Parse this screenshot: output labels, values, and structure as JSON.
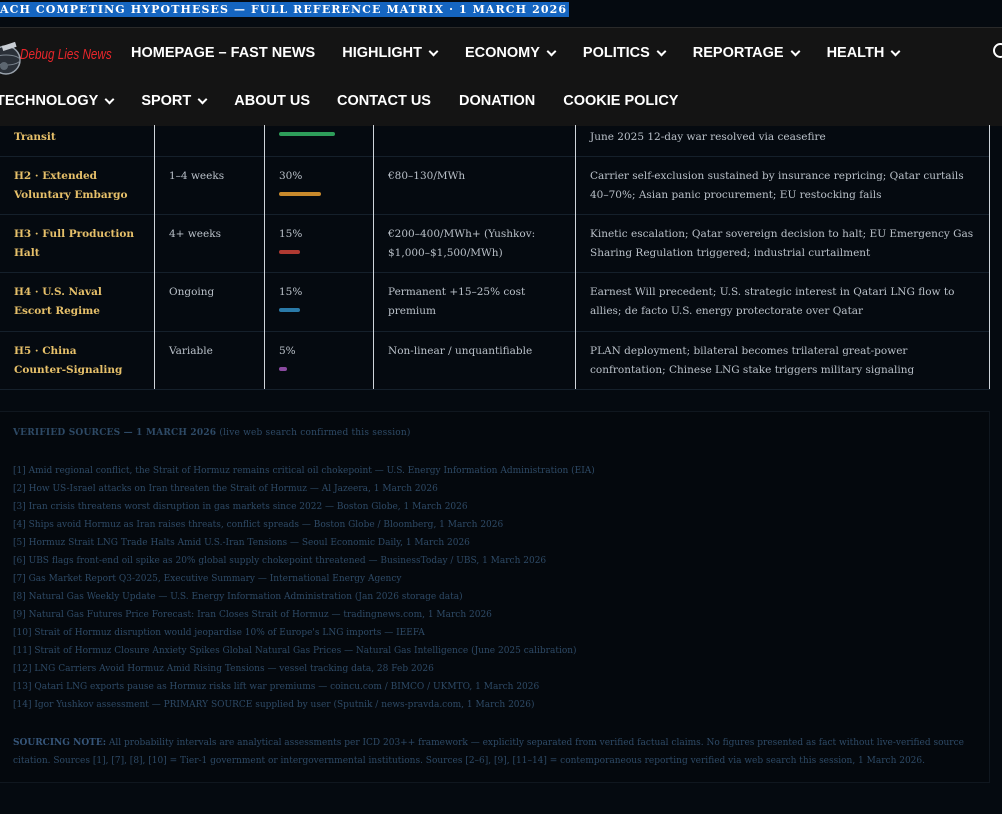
{
  "banner": {
    "text": "ACH COMPETING HYPOTHESES — FULL REFERENCE MATRIX · 1 MARCH 2026"
  },
  "logo": {
    "text": "Debug Lies News"
  },
  "nav": {
    "row1": [
      {
        "label": "HOMEPAGE – FAST NEWS",
        "dropdown": false
      },
      {
        "label": "HIGHLIGHT",
        "dropdown": true
      },
      {
        "label": "ECONOMY",
        "dropdown": true
      },
      {
        "label": "POLITICS",
        "dropdown": true
      },
      {
        "label": "REPORTAGE",
        "dropdown": true
      },
      {
        "label": "HEALTH",
        "dropdown": true
      }
    ],
    "row2": [
      {
        "label": "TECHNOLOGY",
        "dropdown": true
      },
      {
        "label": "SPORT",
        "dropdown": true
      },
      {
        "label": "ABOUT US",
        "dropdown": false
      },
      {
        "label": "CONTACT US",
        "dropdown": false
      },
      {
        "label": "DONATION",
        "dropdown": false
      },
      {
        "label": "COOKIE POLICY",
        "dropdown": false
      }
    ]
  },
  "table": {
    "rows": [
      {
        "hypothesis": "Transit",
        "duration": "",
        "probability": "",
        "prob_value": 40,
        "bar_color": "#2e9e5a",
        "price": "",
        "triggers": "June 2025 12-day war resolved via ceasefire"
      },
      {
        "hypothesis": "H2 · Extended Voluntary Embargo",
        "duration": "1–4 weeks",
        "probability": "30%",
        "prob_value": 30,
        "bar_color": "#c98a2c",
        "price": "€80–130/MWh",
        "triggers": "Carrier self-exclusion sustained by insurance repricing; Qatar curtails 40–70%; Asian panic procurement; EU restocking fails"
      },
      {
        "hypothesis": "H3 · Full Production Halt",
        "duration": "4+ weeks",
        "probability": "15%",
        "prob_value": 15,
        "bar_color": "#b03a32",
        "price": "€200–400/MWh+ (Yushkov: $1,000–$1,500/MWh)",
        "triggers": "Kinetic escalation; Qatar sovereign decision to halt; EU Emergency Gas Sharing Regulation triggered; industrial curtailment"
      },
      {
        "hypothesis": "H4 · U.S. Naval Escort Regime",
        "duration": "Ongoing",
        "probability": "15%",
        "prob_value": 15,
        "bar_color": "#2a7aa8",
        "price": "Permanent +15–25% cost premium",
        "triggers": "Earnest Will precedent; U.S. strategic interest in Qatari LNG flow to allies; de facto U.S. energy protectorate over Qatar"
      },
      {
        "hypothesis": "H5 · China Counter-Signaling",
        "duration": "Variable",
        "probability": "5%",
        "prob_value": 5,
        "bar_color": "#8a4aa0",
        "price": "Non-linear / unquantifiable",
        "triggers": "PLAN deployment; bilateral becomes trilateral great-power confrontation; Chinese LNG stake triggers military signaling"
      }
    ]
  },
  "sources": {
    "heading_bold": "VERIFIED SOURCES — 1 MARCH 2026",
    "heading_rest": " (live web search confirmed this session)",
    "items": [
      "[1] Amid regional conflict, the Strait of Hormuz remains critical oil chokepoint — U.S. Energy Information Administration (EIA)",
      "[2] How US-Israel attacks on Iran threaten the Strait of Hormuz — Al Jazeera, 1 March 2026",
      "[3] Iran crisis threatens worst disruption in gas markets since 2022 — Boston Globe, 1 March 2026",
      "[4] Ships avoid Hormuz as Iran raises threats, conflict spreads — Boston Globe / Bloomberg, 1 March 2026",
      "[5] Hormuz Strait LNG Trade Halts Amid U.S.-Iran Tensions — Seoul Economic Daily, 1 March 2026",
      "[6] UBS flags front-end oil spike as 20% global supply chokepoint threatened — BusinessToday / UBS, 1 March 2026",
      "[7] Gas Market Report Q3-2025, Executive Summary — International Energy Agency",
      "[8] Natural Gas Weekly Update — U.S. Energy Information Administration (Jan 2026 storage data)",
      "[9] Natural Gas Futures Price Forecast: Iran Closes Strait of Hormuz — tradingnews.com, 1 March 2026",
      "[10] Strait of Hormuz disruption would jeopardise 10% of Europe's LNG imports — IEEFA",
      "[11] Strait of Hormuz Closure Anxiety Spikes Global Natural Gas Prices — Natural Gas Intelligence (June 2025 calibration)",
      "[12] LNG Carriers Avoid Hormuz Amid Rising Tensions — vessel tracking data, 28 Feb 2026",
      "[13] Qatari LNG exports pause as Hormuz risks lift war premiums — coincu.com / BIMCO / UKMTO, 1 March 2026",
      "[14] Igor Yushkov assessment — PRIMARY SOURCE supplied by user (Sputnik / news-pravda.com, 1 March 2026)"
    ],
    "note_label": "SOURCING NOTE:",
    "note_text": " All probability intervals are analytical assessments per ICD 203++ framework — explicitly separated from verified factual claims. No figures presented as fact without live-verified source citation. Sources [1], [7], [8], [10] = Tier-1 government or intergovernmental institutions. Sources [2–6], [9], [11–14] = contemporaneous reporting verified via web search this session, 1 March 2026."
  }
}
